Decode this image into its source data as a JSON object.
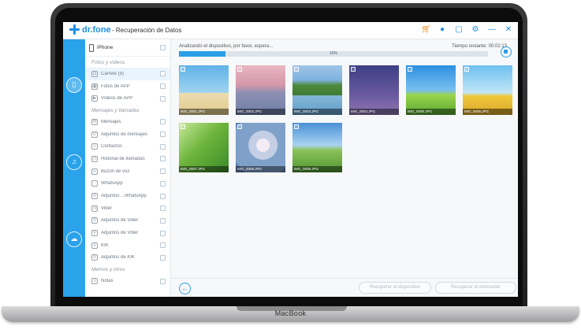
{
  "app": {
    "logo_text": "dr.fone",
    "title": "- Recuperación de Datos",
    "laptop_brand": "MacBook"
  },
  "titlebar_icons": [
    "cart-icon",
    "user-icon",
    "feedback-icon",
    "settings-icon",
    "minimize-icon",
    "close-icon"
  ],
  "rail_icons": [
    "phone-recovery-icon",
    "itunes-recovery-icon",
    "icloud-recovery-icon"
  ],
  "sidebar": {
    "device": "iPhone",
    "sections": [
      {
        "title": "Fotos y vídeos",
        "items": [
          {
            "label": "Carrete (9)",
            "icon": "camera-icon",
            "glyph": "◘",
            "selected": true
          },
          {
            "label": "Fotos de APP",
            "icon": "photo-icon",
            "glyph": "▣",
            "selected": false
          },
          {
            "label": "Vídeos de APP",
            "icon": "video-icon",
            "glyph": "▶",
            "selected": false
          }
        ]
      },
      {
        "title": "Mensajes y llamadas",
        "items": [
          {
            "label": "Mensajes",
            "icon": "message-icon",
            "glyph": "✉",
            "selected": false
          },
          {
            "label": "Adjuntos de mensajes",
            "icon": "attachment-icon",
            "glyph": "⚲",
            "selected": false
          },
          {
            "label": "Contactos",
            "icon": "contact-icon",
            "glyph": "☺",
            "selected": false
          },
          {
            "label": "Historial de llamadas",
            "icon": "call-history-icon",
            "glyph": "◷",
            "selected": false
          },
          {
            "label": "Buzón de voz",
            "icon": "voicemail-icon",
            "glyph": "∞",
            "selected": false
          },
          {
            "label": "WhatsApp",
            "icon": "whatsapp-icon",
            "glyph": "◌",
            "selected": false
          },
          {
            "label": "Adjuntos ...WhatsApp",
            "icon": "whatsapp-attachment-icon",
            "glyph": "⚲",
            "selected": false
          },
          {
            "label": "Viber",
            "icon": "viber-icon",
            "glyph": "☏",
            "selected": false
          },
          {
            "label": "Adjuntos de Viber",
            "icon": "viber-attachment-icon",
            "glyph": "⚲",
            "selected": false
          },
          {
            "label": "Adjuntos de Viber",
            "icon": "viber-attachment-icon",
            "glyph": "⚲",
            "selected": false
          },
          {
            "label": "KIK",
            "icon": "kik-icon",
            "glyph": "k",
            "selected": false
          },
          {
            "label": "Adjuntos de KIK",
            "icon": "kik-attachment-icon",
            "glyph": "⚲",
            "selected": false
          }
        ]
      },
      {
        "title": "Memos y otros",
        "items": [
          {
            "label": "Notas",
            "icon": "notes-icon",
            "glyph": "≡",
            "selected": false
          }
        ]
      }
    ]
  },
  "scan": {
    "status": "Analizando el dispositivo, por favor, espera...",
    "remaining": "Tiempo restante: 00:02:13",
    "progress_label": "15%",
    "progress": 0.15
  },
  "photos": [
    "IMG_0001.JPG",
    "IMG_0002.JPG",
    "IMG_0003.JPG",
    "IMG_0004.JPG",
    "IMG_0005.JPG",
    "IMG_0006.JPG",
    "IMG_0007.JPG",
    "IMG_0008.JPG",
    "IMG_0009.JPG"
  ],
  "buttons": {
    "recover_device": "Recuperar al dispositivo",
    "recover_computer": "Recuperar al ordenador"
  }
}
